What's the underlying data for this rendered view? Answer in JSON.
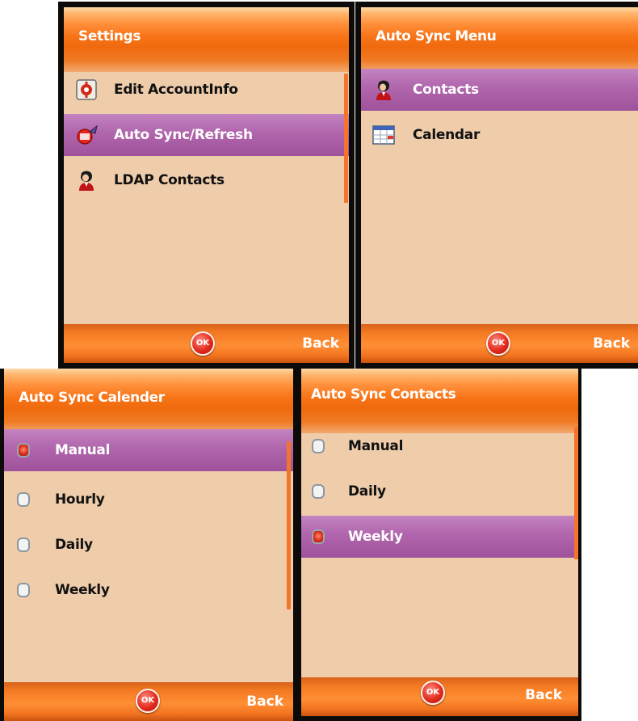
{
  "screens": [
    {
      "title": "Settings",
      "items": [
        {
          "label": "Edit AccountInfo",
          "icon": "account-info-icon",
          "selected": false
        },
        {
          "label": "Auto Sync/Refresh",
          "icon": "sync-refresh-icon",
          "selected": true
        },
        {
          "label": "LDAP Contacts",
          "icon": "contact-person-icon",
          "selected": false
        }
      ],
      "ok_label": "OK",
      "back_label": "Back"
    },
    {
      "title": "Auto Sync Menu",
      "items": [
        {
          "label": "Contacts",
          "icon": "contact-person-icon",
          "selected": true
        },
        {
          "label": "Calendar",
          "icon": "calendar-icon",
          "selected": false
        }
      ],
      "ok_label": "OK",
      "back_label": "Back"
    },
    {
      "title": "Auto Sync Calender",
      "options": [
        {
          "label": "Manual",
          "checked": true,
          "selected": true
        },
        {
          "label": "Hourly",
          "checked": false,
          "selected": false
        },
        {
          "label": "Daily",
          "checked": false,
          "selected": false
        },
        {
          "label": "Weekly",
          "checked": false,
          "selected": false
        }
      ],
      "ok_label": "OK",
      "back_label": "Back"
    },
    {
      "title": "Auto Sync Contacts",
      "options": [
        {
          "label": "Manual",
          "checked": false,
          "selected": false
        },
        {
          "label": "Daily",
          "checked": false,
          "selected": false
        },
        {
          "label": "Weekly",
          "checked": true,
          "selected": true
        }
      ],
      "ok_label": "OK",
      "back_label": "Back"
    }
  ],
  "colors": {
    "header_orange": "#f77316",
    "content_bg": "#efcdaa",
    "selection_purple": "#b065ac",
    "scrollbar": "#f4742b",
    "ok_red": "#e32b1d"
  }
}
